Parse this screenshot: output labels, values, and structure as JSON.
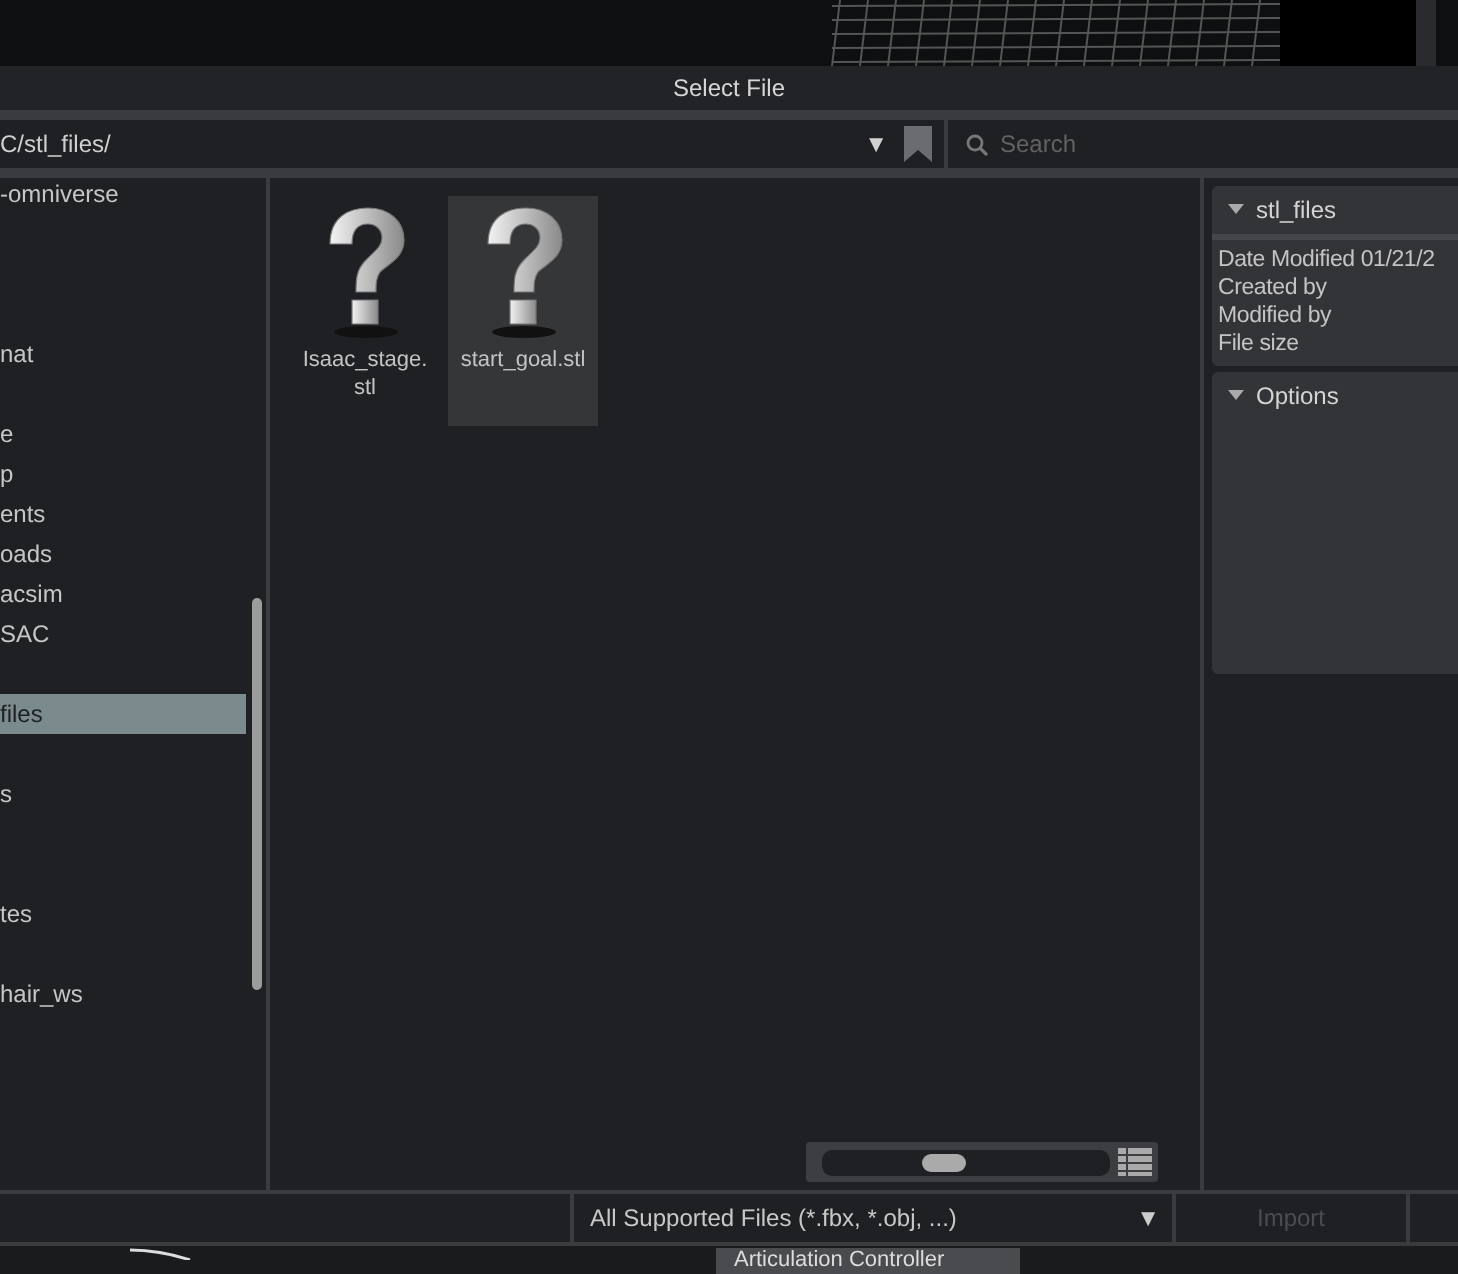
{
  "window": {
    "title": "Select File"
  },
  "path_bar": {
    "path": "C/stl_files/",
    "dropdown": "▼"
  },
  "search": {
    "placeholder": "Search"
  },
  "sidebar": {
    "items": [
      {
        "kind": "folder",
        "label": "-omniverse",
        "selected": false
      },
      {
        "kind": "blank"
      },
      {
        "kind": "blank"
      },
      {
        "kind": "blank"
      },
      {
        "kind": "folder",
        "label": "nat",
        "selected": false
      },
      {
        "kind": "blank"
      },
      {
        "kind": "folder",
        "label": "e",
        "selected": false
      },
      {
        "kind": "folder",
        "label": "p",
        "selected": false
      },
      {
        "kind": "folder",
        "label": "ents",
        "selected": false
      },
      {
        "kind": "folder",
        "label": "oads",
        "selected": false
      },
      {
        "kind": "folder",
        "label": "acsim",
        "selected": false
      },
      {
        "kind": "folder",
        "label": "SAC",
        "selected": false
      },
      {
        "kind": "blank"
      },
      {
        "kind": "folder",
        "label": "files",
        "selected": true
      },
      {
        "kind": "blank"
      },
      {
        "kind": "folder",
        "label": "s",
        "selected": false
      },
      {
        "kind": "blank"
      },
      {
        "kind": "blank"
      },
      {
        "kind": "folder",
        "label": "tes",
        "selected": false
      },
      {
        "kind": "blank"
      },
      {
        "kind": "folder",
        "label": "hair_ws",
        "selected": false
      }
    ]
  },
  "files": [
    {
      "name": "Isaac_stage.\nstl",
      "selected": false
    },
    {
      "name": "start_goal.stl",
      "selected": true
    }
  ],
  "zoom_slider": {
    "level": 0.42
  },
  "info_panel": {
    "sections": [
      {
        "title": "stl_files",
        "expanded": true,
        "lines": [
          "Date Modified 01/21/2",
          "Created by",
          "Modified by",
          "File size"
        ]
      },
      {
        "title": "Options",
        "expanded": true
      }
    ]
  },
  "footer": {
    "filter": "All Supported Files (*.fbx, *.obj, ...)",
    "filter_arrow": "▼",
    "import": {
      "label": "Import",
      "disabled": true
    }
  },
  "background": {
    "label": "Articulation Controller"
  }
}
